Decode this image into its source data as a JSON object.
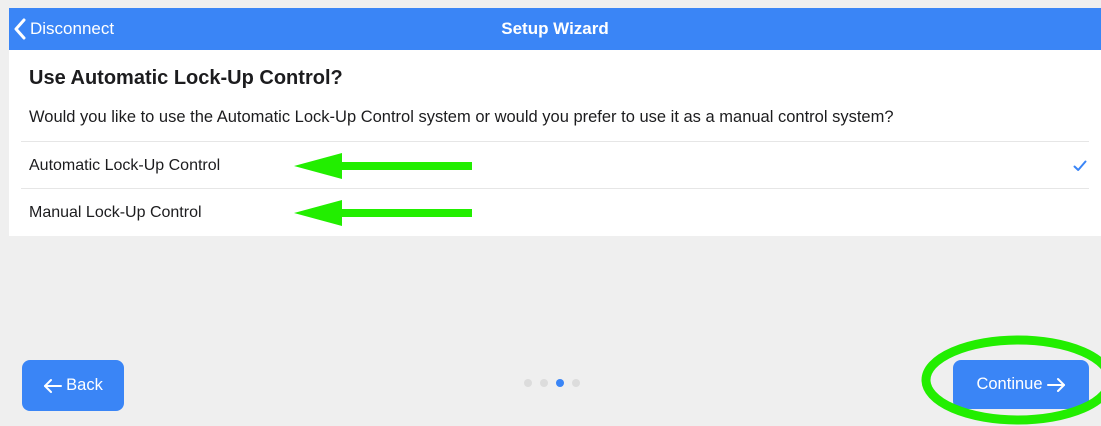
{
  "navbar": {
    "back_label": "Disconnect",
    "title": "Setup Wizard",
    "color": "#3a85f6"
  },
  "step": {
    "heading": "Use Automatic Lock-Up Control?",
    "description": "Would you like to use the Automatic Lock-Up Control system or would you prefer to use it as a manual control system?",
    "options": [
      {
        "label": "Automatic Lock-Up Control",
        "selected": true
      },
      {
        "label": "Manual Lock-Up Control",
        "selected": false
      }
    ]
  },
  "footer": {
    "back_label": "Back",
    "continue_label": "Continue",
    "page_indicator": {
      "total": 4,
      "current": 3
    }
  },
  "icons": {
    "nav_back": "chevron-left-icon",
    "selected": "checkmark-icon",
    "back_button": "arrow-left-icon",
    "continue_button": "arrow-right-icon"
  },
  "annotations": {
    "color": "#22ee00",
    "shapes": [
      "arrow",
      "arrow",
      "ellipse"
    ]
  }
}
